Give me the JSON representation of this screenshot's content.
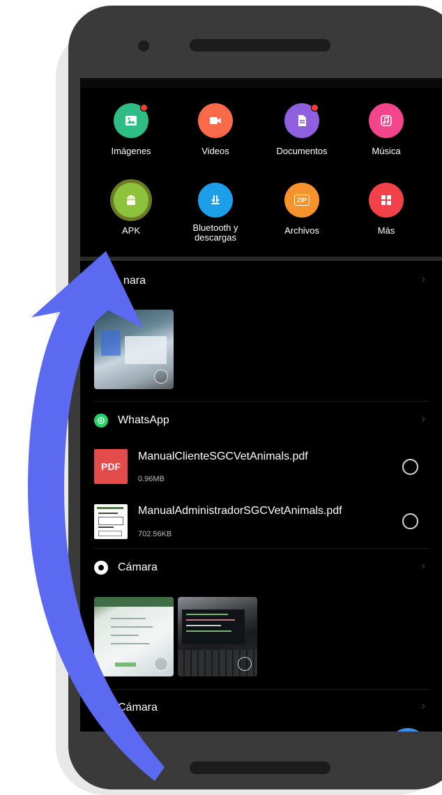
{
  "colors": {
    "images": "#2ebd84",
    "videos": "#f96a4b",
    "documents": "#8e60e0",
    "music": "#f2458c",
    "apk": "#8cc23c",
    "bluetooth": "#1d9ee8",
    "archives": "#f7932b",
    "more": "#f24148",
    "arrow": "#5b6af0",
    "whatsapp": "#25d366"
  },
  "categories": [
    {
      "id": "images",
      "label": "Imágenes",
      "icon": "image-icon",
      "badge": true
    },
    {
      "id": "videos",
      "label": "Videos",
      "icon": "video-icon",
      "badge": false
    },
    {
      "id": "documents",
      "label": "Documentos",
      "icon": "document-icon",
      "badge": true
    },
    {
      "id": "music",
      "label": "Música",
      "icon": "music-note-icon",
      "badge": false
    },
    {
      "id": "apk",
      "label": "APK",
      "icon": "android-icon",
      "badge": false
    },
    {
      "id": "bluetooth",
      "label_line1": "Bluetooth y",
      "label_line2": "descargas",
      "icon": "download-icon",
      "badge": false
    },
    {
      "id": "archives",
      "label": "Archivos",
      "icon": "zip-icon",
      "icon_text": "ZIP",
      "badge": false
    },
    {
      "id": "more",
      "label": "Más",
      "icon": "grid-icon",
      "badge": false
    }
  ],
  "sections": [
    {
      "title": "nara",
      "icon": "camera-icon"
    },
    {
      "title": "WhatsApp",
      "icon": "whatsapp-icon"
    },
    {
      "title": "Cámara",
      "icon": "camera-icon"
    },
    {
      "title": "Cámara",
      "icon": "camera-icon"
    }
  ],
  "chevron": "›",
  "files": [
    {
      "name": "ManualClienteSGCVetAnimals.pdf",
      "size": "0.96MB",
      "icon": "pdf-icon",
      "icon_text": "PDF"
    },
    {
      "name": "ManualAdministradorSGCVetAnimals.pdf",
      "size": "702.56KB",
      "icon": "document-thumbnail-icon"
    }
  ]
}
